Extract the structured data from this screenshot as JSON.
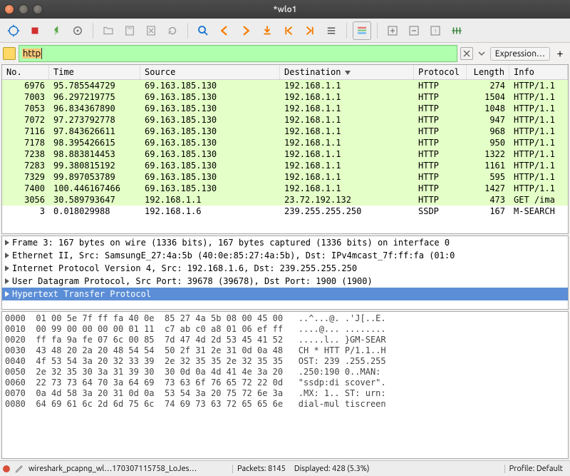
{
  "window": {
    "title": "*wlo1"
  },
  "filter": {
    "text": "http",
    "expression_label": "Expression…"
  },
  "columns": {
    "no": "No.",
    "time": "Time",
    "src": "Source",
    "dst": "Destination",
    "proto": "Protocol",
    "len": "Length",
    "info": "Info"
  },
  "packets": [
    {
      "no": "6976",
      "time": "95.785544729",
      "src": "69.163.185.130",
      "dst": "192.168.1.1",
      "proto": "HTTP",
      "len": "274",
      "info": "HTTP/1.1",
      "cls": "http"
    },
    {
      "no": "7003",
      "time": "96.297219775",
      "src": "69.163.185.130",
      "dst": "192.168.1.1",
      "proto": "HTTP",
      "len": "1504",
      "info": "HTTP/1.1",
      "cls": "http"
    },
    {
      "no": "7053",
      "time": "96.834367890",
      "src": "69.163.185.130",
      "dst": "192.168.1.1",
      "proto": "HTTP",
      "len": "1048",
      "info": "HTTP/1.1",
      "cls": "http"
    },
    {
      "no": "7072",
      "time": "97.273792778",
      "src": "69.163.185.130",
      "dst": "192.168.1.1",
      "proto": "HTTP",
      "len": "947",
      "info": "HTTP/1.1",
      "cls": "http"
    },
    {
      "no": "7116",
      "time": "97.843626611",
      "src": "69.163.185.130",
      "dst": "192.168.1.1",
      "proto": "HTTP",
      "len": "968",
      "info": "HTTP/1.1",
      "cls": "http"
    },
    {
      "no": "7178",
      "time": "98.395426615",
      "src": "69.163.185.130",
      "dst": "192.168.1.1",
      "proto": "HTTP",
      "len": "950",
      "info": "HTTP/1.1",
      "cls": "http"
    },
    {
      "no": "7238",
      "time": "98.883814453",
      "src": "69.163.185.130",
      "dst": "192.168.1.1",
      "proto": "HTTP",
      "len": "1322",
      "info": "HTTP/1.1",
      "cls": "http"
    },
    {
      "no": "7283",
      "time": "99.380815192",
      "src": "69.163.185.130",
      "dst": "192.168.1.1",
      "proto": "HTTP",
      "len": "1161",
      "info": "HTTP/1.1",
      "cls": "http"
    },
    {
      "no": "7329",
      "time": "99.897053789",
      "src": "69.163.185.130",
      "dst": "192.168.1.1",
      "proto": "HTTP",
      "len": "595",
      "info": "HTTP/1.1",
      "cls": "http"
    },
    {
      "no": "7400",
      "time": "100.446167466",
      "src": "69.163.185.130",
      "dst": "192.168.1.1",
      "proto": "HTTP",
      "len": "1427",
      "info": "HTTP/1.1",
      "cls": "http"
    },
    {
      "no": "3056",
      "time": "30.589793647",
      "src": "192.168.1.1",
      "dst": "23.72.192.132",
      "proto": "HTTP",
      "len": "473",
      "info": "GET  /ima",
      "cls": "http"
    },
    {
      "no": "3",
      "time": "0.018029988",
      "src": "192.168.1.6",
      "dst": "239.255.255.250",
      "proto": "SSDP",
      "len": "167",
      "info": "M-SEARCH",
      "cls": "ssdp"
    }
  ],
  "details": [
    "Frame 3: 167 bytes on wire (1336 bits), 167 bytes captured (1336 bits) on interface 0",
    "Ethernet II, Src: SamsungE_27:4a:5b (40:0e:85:27:4a:5b), Dst: IPv4mcast_7f:ff:fa (01:0",
    "Internet Protocol Version 4, Src: 192.168.1.6, Dst: 239.255.255.250",
    "User Datagram Protocol, Src Port: 39678 (39678), Dst Port: 1900 (1900)",
    "Hypertext Transfer Protocol"
  ],
  "hex": [
    {
      "off": "0000",
      "b": "01 00 5e 7f ff fa 40 0e  85 27 4a 5b 08 00 45 00",
      "a": "..^...@. .'J[..E."
    },
    {
      "off": "0010",
      "b": "00 99 00 00 00 00 01 11  c7 ab c0 a8 01 06 ef ff",
      "a": "....@... ........"
    },
    {
      "off": "0020",
      "b": "ff fa 9a fe 07 6c 00 85  7d 47 4d 2d 53 45 41 52",
      "a": ".....l.. }GM-SEAR"
    },
    {
      "off": "0030",
      "b": "43 48 20 2a 20 48 54 54  50 2f 31 2e 31 0d 0a 48",
      "a": "CH * HTT P/1.1..H"
    },
    {
      "off": "0040",
      "b": "4f 53 54 3a 20 32 33 39  2e 32 35 35 2e 32 35 35",
      "a": "OST: 239 .255.255"
    },
    {
      "off": "0050",
      "b": "2e 32 35 30 3a 31 39 30  30 0d 0a 4d 41 4e 3a 20",
      "a": ".250:190 0..MAN: "
    },
    {
      "off": "0060",
      "b": "22 73 73 64 70 3a 64 69  73 63 6f 76 65 72 22 0d",
      "a": "\"ssdp:di scover\"."
    },
    {
      "off": "0070",
      "b": "0a 4d 58 3a 20 31 0d 0a  53 54 3a 20 75 72 6e 3a",
      "a": ".MX: 1.. ST: urn:"
    },
    {
      "off": "0080",
      "b": "64 69 61 6c 2d 6d 75 6c  74 69 73 63 72 65 65 6e",
      "a": "dial-mul tiscreen"
    }
  ],
  "status": {
    "file": "wireshark_pcapng_wl…170307115758_LoJes…",
    "packets": "Packets: 8145",
    "displayed": "Displayed: 428 (5.3%)",
    "profile": "Profile: Default"
  }
}
